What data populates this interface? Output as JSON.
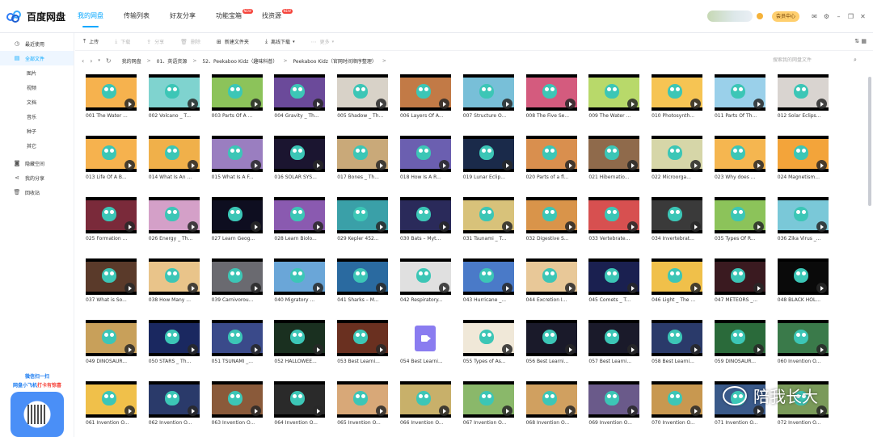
{
  "app": {
    "logo_text": "百度网盘"
  },
  "nav": [
    {
      "label": "我的网盘",
      "badge": ""
    },
    {
      "label": "传输列表",
      "badge": ""
    },
    {
      "label": "好友分享",
      "badge": ""
    },
    {
      "label": "功能宝箱",
      "badge": "NEW"
    },
    {
      "label": "找资源",
      "badge": "NEW"
    }
  ],
  "header": {
    "vip_label": "会员中心"
  },
  "sidebar": {
    "items": [
      {
        "icon": "clock-icon",
        "glyph": "◷",
        "label": "最近使用",
        "sub": false,
        "active": false
      },
      {
        "icon": "file-icon",
        "glyph": "▤",
        "label": "全部文件",
        "sub": false,
        "active": true
      },
      {
        "icon": "",
        "glyph": "",
        "label": "图片",
        "sub": true,
        "active": false
      },
      {
        "icon": "",
        "glyph": "",
        "label": "视频",
        "sub": true,
        "active": false
      },
      {
        "icon": "",
        "glyph": "",
        "label": "文档",
        "sub": true,
        "active": false
      },
      {
        "icon": "",
        "glyph": "",
        "label": "音乐",
        "sub": true,
        "active": false
      },
      {
        "icon": "",
        "glyph": "",
        "label": "种子",
        "sub": true,
        "active": false
      },
      {
        "icon": "",
        "glyph": "",
        "label": "其它",
        "sub": true,
        "active": false
      },
      {
        "icon": "hidden-space-icon",
        "glyph": "◙",
        "label": "隐藏空间",
        "sub": false,
        "active": false
      },
      {
        "icon": "share-icon",
        "glyph": "⋖",
        "label": "我的分享",
        "sub": false,
        "active": false
      },
      {
        "icon": "trash-icon",
        "glyph": "🗑",
        "label": "回收站",
        "sub": false,
        "active": false
      }
    ],
    "promo_line1": "微信扫一扫",
    "promo_line2_a": "网盘小飞机",
    "promo_line2_b": "打卡有惊喜"
  },
  "toolbar": {
    "upload": "上传",
    "download": "下载",
    "share": "分享",
    "delete": "删除",
    "new_folder": "新建文件夹",
    "offline": "离线下载",
    "more": "更多"
  },
  "path": {
    "crumbs": [
      "我的网盘",
      "01、英语资源",
      "52、Peekaboo Kidz（趣味科普）",
      "Peekaboo Kidz（官网时间顺序整理）"
    ],
    "search_placeholder": "搜索我的网盘文件"
  },
  "files": [
    {
      "name": "001 The Water ...",
      "type": "video",
      "bg": "#f6b24e"
    },
    {
      "name": "002 Volcano _ T...",
      "type": "video",
      "bg": "#7fd3cf"
    },
    {
      "name": "003 Parts Of A ...",
      "type": "video",
      "bg": "#8cc35a"
    },
    {
      "name": "004 Gravity _ Th...",
      "type": "video",
      "bg": "#6b4a9a"
    },
    {
      "name": "005 Shadow _ Th...",
      "type": "video",
      "bg": "#d8d2c8"
    },
    {
      "name": "006 Layers Of A...",
      "type": "video",
      "bg": "#c27a46"
    },
    {
      "name": "007 Structure O...",
      "type": "video",
      "bg": "#78bfd8"
    },
    {
      "name": "008 The Five Se...",
      "type": "video",
      "bg": "#d45b7e"
    },
    {
      "name": "009 The Water ...",
      "type": "video",
      "bg": "#b8d96a"
    },
    {
      "name": "010 Photosynth...",
      "type": "video",
      "bg": "#f6c453"
    },
    {
      "name": "011 Parts Of Th...",
      "type": "video",
      "bg": "#9ad0ea"
    },
    {
      "name": "012 Solar Eclips...",
      "type": "video",
      "bg": "#d9d4d0"
    },
    {
      "name": "013 Life Of A B...",
      "type": "video",
      "bg": "#f6b24e"
    },
    {
      "name": "014 What Is An ...",
      "type": "video",
      "bg": "#f0b04a"
    },
    {
      "name": "015 What Is A F...",
      "type": "video",
      "bg": "#9a7ec0"
    },
    {
      "name": "016 SOLAR SYS...",
      "type": "video",
      "bg": "#1b1530"
    },
    {
      "name": "017 Bones _ Th...",
      "type": "video",
      "bg": "#c9a979"
    },
    {
      "name": "018 How Is A R...",
      "type": "video",
      "bg": "#6b5fb0"
    },
    {
      "name": "019 Lunar Eclip...",
      "type": "video",
      "bg": "#1a2a4a"
    },
    {
      "name": "020 Parts of a fl...",
      "type": "video",
      "bg": "#d98f4e"
    },
    {
      "name": "021 Hibernatio...",
      "type": "video",
      "bg": "#8f6a4b"
    },
    {
      "name": "022 Microorga...",
      "type": "video",
      "bg": "#d6d6a8"
    },
    {
      "name": "023 Why does ...",
      "type": "video",
      "bg": "#f5b650"
    },
    {
      "name": "024 Magnetism...",
      "type": "video",
      "bg": "#f3a43a"
    },
    {
      "name": "025 Formation ...",
      "type": "video",
      "bg": "#7a2a3a"
    },
    {
      "name": "026 Energy _ Th...",
      "type": "video",
      "bg": "#d4a0c8"
    },
    {
      "name": "027 Learn Geog...",
      "type": "video",
      "bg": "#0e0e20"
    },
    {
      "name": "028 Learn Biolo...",
      "type": "video",
      "bg": "#8a5ab0"
    },
    {
      "name": "029 Kepler 452...",
      "type": "video",
      "bg": "#3aa0a8"
    },
    {
      "name": "030 Bats – Myt...",
      "type": "video",
      "bg": "#2a2a5a"
    },
    {
      "name": "031 Tsunami _ T...",
      "type": "video",
      "bg": "#d8c27a"
    },
    {
      "name": "032 Digestive S...",
      "type": "video",
      "bg": "#d9944a"
    },
    {
      "name": "033 Vertebrate...",
      "type": "video",
      "bg": "#d75050"
    },
    {
      "name": "034 Invertebrat...",
      "type": "video",
      "bg": "#3a3a3a"
    },
    {
      "name": "035 Types Of R...",
      "type": "video",
      "bg": "#8cc35a"
    },
    {
      "name": "036 Zika Virus _...",
      "type": "video",
      "bg": "#7ac8d8"
    },
    {
      "name": "037 What is So...",
      "type": "video",
      "bg": "#5a3a2a"
    },
    {
      "name": "038 How Many ...",
      "type": "video",
      "bg": "#e9c48a"
    },
    {
      "name": "039 Carnivorou...",
      "type": "video",
      "bg": "#6a6a70"
    },
    {
      "name": "040 Migratory ...",
      "type": "video",
      "bg": "#6aa6d8"
    },
    {
      "name": "041 Sharks – M...",
      "type": "video",
      "bg": "#2a6aa0"
    },
    {
      "name": "042 Respiratory...",
      "type": "video",
      "bg": "#e0e0e0"
    },
    {
      "name": "043 Hurricane _...",
      "type": "video",
      "bg": "#4a7ac8"
    },
    {
      "name": "044 Excretion I...",
      "type": "video",
      "bg": "#e8c898"
    },
    {
      "name": "045 Comets _ T...",
      "type": "video",
      "bg": "#1a2050"
    },
    {
      "name": "046 Light _ The ...",
      "type": "video",
      "bg": "#f0c04a"
    },
    {
      "name": "047 METEORS _...",
      "type": "video",
      "bg": "#3a1a20"
    },
    {
      "name": "048 BLACK HOL...",
      "type": "video",
      "bg": "#0a0a0a"
    },
    {
      "name": "049 DINOSAUR...",
      "type": "video",
      "bg": "#c8a05a"
    },
    {
      "name": "050 STARS _ Th...",
      "type": "video",
      "bg": "#1a2860"
    },
    {
      "name": "051 TSUNAMI _...",
      "type": "video",
      "bg": "#3a4a8a"
    },
    {
      "name": "052 HALLOWEE...",
      "type": "video",
      "bg": "#1a3020"
    },
    {
      "name": "053 Best Learni...",
      "type": "video",
      "bg": "#6a3020"
    },
    {
      "name": "054 Best Learni...",
      "type": "doc",
      "bg": "#ffffff"
    },
    {
      "name": "055 Types of As...",
      "type": "video",
      "bg": "#f0e8d8"
    },
    {
      "name": "056 Best Learni...",
      "type": "video",
      "bg": "#1a1a2a"
    },
    {
      "name": "057 Best Learni...",
      "type": "video",
      "bg": "#1a1a2a"
    },
    {
      "name": "058 Best Learni...",
      "type": "video",
      "bg": "#2a3a6a"
    },
    {
      "name": "059 DINOSAUR...",
      "type": "video",
      "bg": "#2a6a3a"
    },
    {
      "name": "060 Invention O...",
      "type": "video",
      "bg": "#3a7a4a"
    },
    {
      "name": "061 Invention O...",
      "type": "video",
      "bg": "#f0c04a"
    },
    {
      "name": "062 Invention O...",
      "type": "video",
      "bg": "#2a3a6a"
    },
    {
      "name": "063 Invention O...",
      "type": "video",
      "bg": "#8a5a3a"
    },
    {
      "name": "064 Invention O...",
      "type": "video",
      "bg": "#2a2a2a"
    },
    {
      "name": "065 Invention O...",
      "type": "video",
      "bg": "#d8a878"
    },
    {
      "name": "066 Invention O...",
      "type": "video",
      "bg": "#c8b06a"
    },
    {
      "name": "067 Invention O...",
      "type": "video",
      "bg": "#8ab86a"
    },
    {
      "name": "068 Invention O...",
      "type": "video",
      "bg": "#d0a060"
    },
    {
      "name": "069 Invention O...",
      "type": "video",
      "bg": "#6a5a8a"
    },
    {
      "name": "070 Invention O...",
      "type": "video",
      "bg": "#c89850"
    },
    {
      "name": "071 Invention O...",
      "type": "video",
      "bg": "#3a5a8a"
    },
    {
      "name": "072 Invention O...",
      "type": "video",
      "bg": "#7a9a5a"
    }
  ],
  "watermark": {
    "text": "陪我长大"
  },
  "colors": {
    "accent": "#06a7ff",
    "vip": "#ffcf6e",
    "badge": "#f5433a"
  }
}
